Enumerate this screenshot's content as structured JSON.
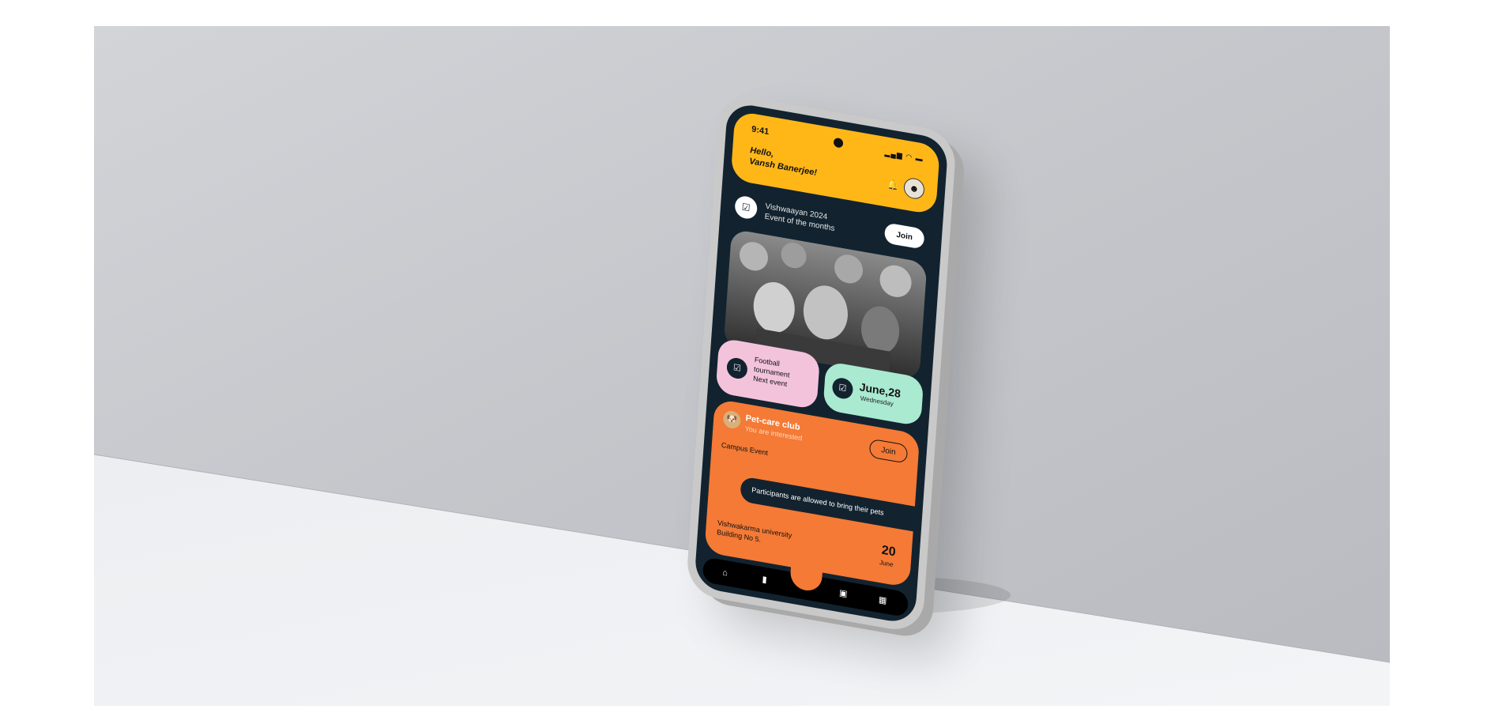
{
  "status_bar": {
    "time": "9:41",
    "signal": "▂▄▆ ◠ ▬"
  },
  "header": {
    "greeting_line1": "Hello,",
    "greeting_line2": "Vansh Banerjee!",
    "bell_icon": "bell-icon",
    "avatar_icon": "user-avatar"
  },
  "event": {
    "title": "Vishwaayan 2024",
    "subtitle": "Event of the months",
    "join_label": "Join",
    "icon": "calendar-check-icon"
  },
  "next_event": {
    "line1": "Football",
    "line2": "tournament",
    "line3": "Next event",
    "icon": "calendar-check-icon"
  },
  "date_card": {
    "date": "June,28",
    "weekday": "Wednesday",
    "icon": "calendar-check-icon"
  },
  "club_card": {
    "name": "Pet-care club",
    "status": "You are interested",
    "join_label": "Join",
    "category": "Campus Event",
    "notice": "Participants are allowed to bring their pets",
    "venue_line1": "Vishwakarma university",
    "venue_line2": "Building No 5.",
    "day": "20",
    "month": "June"
  },
  "nav": {
    "items": [
      "home-icon",
      "document-icon",
      "id-card-icon",
      "calendar-icon"
    ]
  },
  "colors": {
    "header_yellow": "#ffb718",
    "screen_dark": "#12232f",
    "card_pink": "#f3c3dc",
    "card_mint": "#a9ead1",
    "card_orange": "#f47a35"
  }
}
